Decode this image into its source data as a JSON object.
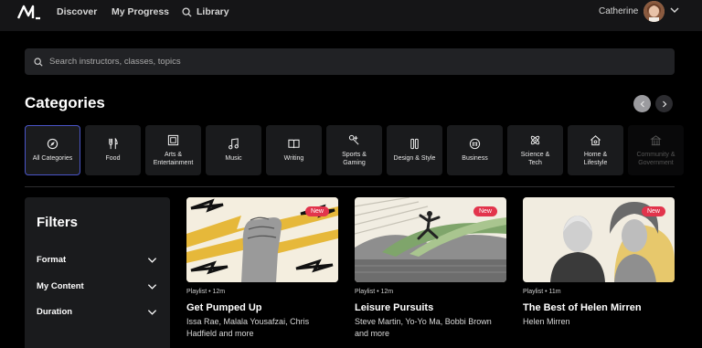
{
  "nav": {
    "discover": "Discover",
    "my_progress": "My Progress",
    "library": "Library",
    "user_name": "Catherine"
  },
  "search": {
    "placeholder": "Search instructors, classes, topics"
  },
  "categories": {
    "title": "Categories",
    "items": [
      {
        "label": "All Categories",
        "icon": "compass-icon"
      },
      {
        "label": "Food",
        "icon": "utensils-icon"
      },
      {
        "label": "Arts &\nEntertainment",
        "icon": "film-icon"
      },
      {
        "label": "Music",
        "icon": "music-note-icon"
      },
      {
        "label": "Writing",
        "icon": "book-icon"
      },
      {
        "label": "Sports &\nGaming",
        "icon": "controller-icon"
      },
      {
        "label": "Design & Style",
        "icon": "pencils-icon"
      },
      {
        "label": "Business",
        "icon": "briefcase-icon"
      },
      {
        "label": "Science &\nTech",
        "icon": "atom-icon"
      },
      {
        "label": "Home &\nLifestyle",
        "icon": "house-icon"
      },
      {
        "label": "Community &\nGovernment",
        "icon": "building-icon"
      }
    ]
  },
  "filters": {
    "title": "Filters",
    "rows": [
      "Format",
      "My Content",
      "Duration"
    ]
  },
  "cards": [
    {
      "badge": "New",
      "meta": "Playlist • 12m",
      "title": "Get Pumped Up",
      "subtitle": "Issa Rae, Malala Yousafzai, Chris Hadfield and more"
    },
    {
      "badge": "New",
      "meta": "Playlist • 12m",
      "title": "Leisure Pursuits",
      "subtitle": "Steve Martin, Yo-Yo Ma, Bobbi Brown and more"
    },
    {
      "badge": "New",
      "meta": "Playlist • 11m",
      "title": "The Best of Helen Mirren",
      "subtitle": "Helen Mirren"
    }
  ],
  "colors": {
    "badge": "#e2344c",
    "active_border": "#4a55c7",
    "tile_bg": "#1a1b1d",
    "topbar_bg": "#151517"
  }
}
